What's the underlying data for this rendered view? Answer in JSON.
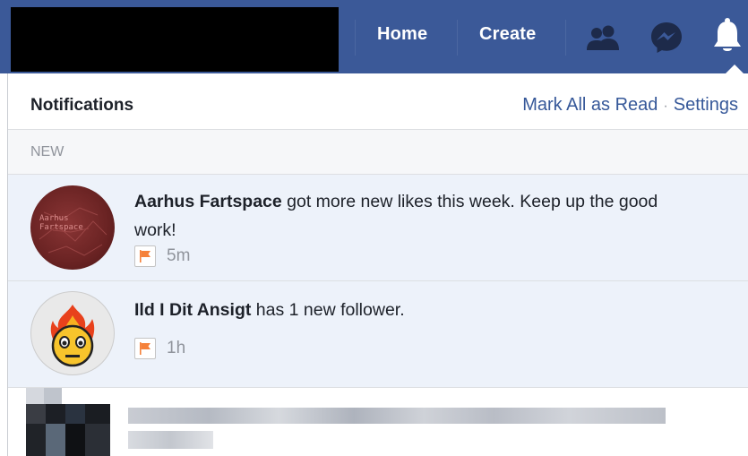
{
  "nav": {
    "home_label": "Home",
    "create_label": "Create",
    "icons": [
      "friends-icon",
      "messenger-icon",
      "notifications-bell-icon"
    ]
  },
  "panel": {
    "title": "Notifications",
    "mark_all_read_label": "Mark All as Read",
    "separator": "·",
    "settings_label": "Settings",
    "section_label": "NEW"
  },
  "notifications": [
    {
      "actor": "Aarhus Fartspace",
      "message": " got more new likes this week. Keep up the good work!",
      "time": "5m",
      "avatar_text": "Aarhus Fartspace"
    },
    {
      "actor": "Ild I Dit Ansigt",
      "message": " has 1 new follower.",
      "time": "1h"
    }
  ],
  "colors": {
    "brand_blue": "#3b5998",
    "link_blue": "#365899",
    "unread_bg": "#edf2fa",
    "flag_orange": "#f5813a"
  }
}
